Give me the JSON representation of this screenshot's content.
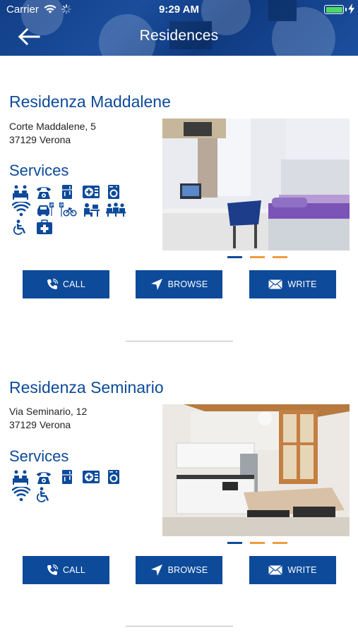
{
  "status": {
    "carrier": "Carrier",
    "time": "9:29 AM"
  },
  "header": {
    "title": "Residences",
    "back_icon": "arrow-left-icon"
  },
  "colors": {
    "brand_blue": "#0d4a9a",
    "accent_orange": "#f09a3e",
    "header_blue": "#1a4d9c"
  },
  "residences": [
    {
      "name": "Residenza Maddalene",
      "address_line1": "Corte Maddalene, 5",
      "address_line2": "37129 Verona",
      "services_title": "Services",
      "service_icons": [
        [
          "bedroom-icon",
          "phone-icon",
          "refrigerator-icon",
          "air-conditioning-icon",
          "washing-machine-icon"
        ],
        [
          "wifi-icon",
          "parking-icon",
          "bike-parking-icon",
          "study-room-icon",
          "common-room-icon"
        ],
        [
          "wheelchair-icon",
          "first-aid-icon"
        ]
      ],
      "carousel": {
        "pages": 3,
        "active": 0
      },
      "buttons": {
        "call": "CALL",
        "browse": "BROWSE",
        "write": "WRITE"
      }
    },
    {
      "name": "Residenza Seminario",
      "address_line1": "Via Seminario, 12",
      "address_line2": "37129 Verona",
      "services_title": "Services",
      "service_icons": [
        [
          "bedroom-icon",
          "phone-icon",
          "refrigerator-icon",
          "air-conditioning-icon",
          "washing-machine-icon"
        ],
        [
          "wifi-icon",
          "wheelchair-icon"
        ]
      ],
      "carousel": {
        "pages": 3,
        "active": 0
      },
      "buttons": {
        "call": "CALL",
        "browse": "BROWSE",
        "write": "WRITE"
      }
    }
  ]
}
